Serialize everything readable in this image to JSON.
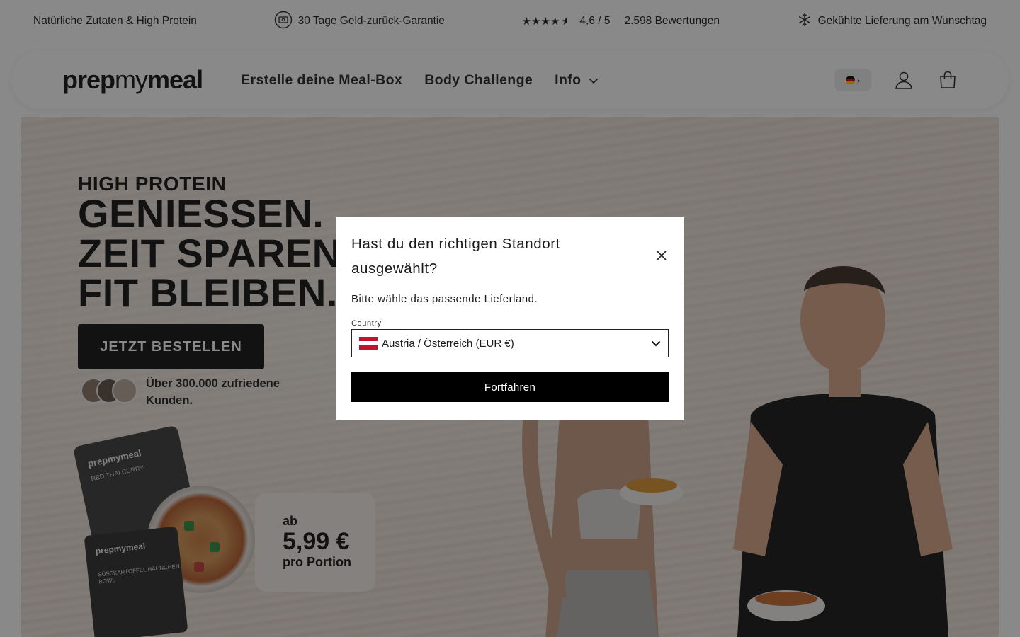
{
  "announcement": {
    "item1": "Natürliche Zutaten & High Protein",
    "item2": "30 Tage Geld-zurück-Garantie",
    "rating": "4,6 / 5",
    "reviews": "2.598 Bewertungen",
    "item4": "Gekühlte Lieferung am Wunschtag"
  },
  "header": {
    "logo_bold": "prep",
    "logo_light": "my",
    "logo_bold2": "meal",
    "nav": {
      "mealbox": "Erstelle deine Meal-Box",
      "challenge": "Body Challenge",
      "info": "Info"
    },
    "country_arrow": "›"
  },
  "hero": {
    "kicker": "HIGH PROTEIN",
    "title_line1": "GENIESSEN.",
    "title_line2": "ZEIT SPAREN.",
    "title_line3": "FIT BLEIBEN.",
    "cta": "JETZT BESTELLEN",
    "customers": "Über 300.000 zufriedene Kunden.",
    "price_prefix": "ab",
    "price": "5,99 €",
    "price_unit": "pro Portion",
    "pack1_title": "prepmymeal",
    "pack1_sub": "RED THAI CURRY",
    "pack2_title": "prepmymeal",
    "pack2_sub": "SÜSSKARTOFFEL HÄHNCHEN BOWL"
  },
  "modal": {
    "title": "Hast du den richtigen Standort ausgewählt?",
    "subtitle": "Bitte wähle das passende Lieferland.",
    "field_label": "Country",
    "selected_country": "Austria / Österreich (EUR €)",
    "submit": "Fortfahren"
  },
  "colors": {
    "overlay": "rgba(20,20,20,0.5)",
    "cta": "#111111",
    "flag_at_red": "#c8102e"
  }
}
